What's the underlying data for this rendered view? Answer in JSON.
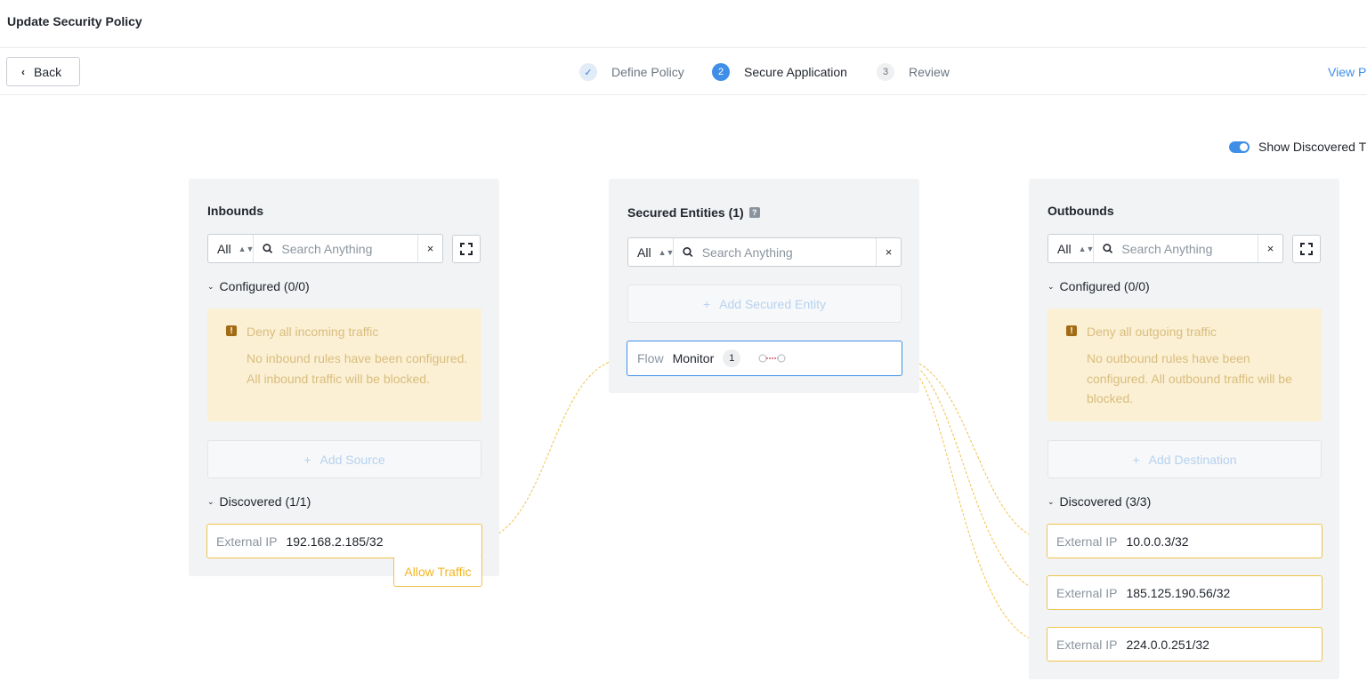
{
  "header": {
    "title": "Update Security Policy"
  },
  "nav": {
    "back_label": "Back",
    "steps": [
      {
        "marker": "✓",
        "label": "Define Policy",
        "state": "done"
      },
      {
        "marker": "2",
        "label": "Secure Application",
        "state": "active"
      },
      {
        "marker": "3",
        "label": "Review",
        "state": "pending"
      }
    ],
    "view_link": "View P"
  },
  "toggle": {
    "label": "Show Discovered T",
    "on": true
  },
  "inbounds": {
    "title": "Inbounds",
    "filter": "All",
    "search_placeholder": "Search Anything",
    "configured_label": "Configured (0/0)",
    "warning_title": "Deny all incoming traffic",
    "warning_text": "No inbound rules have been configured. All inbound traffic will be blocked.",
    "add_label": "Add Source",
    "discovered_label": "Discovered (1/1)",
    "items": [
      {
        "type": "External IP",
        "value": "192.168.2.185/32",
        "tag": "Allow Traffic"
      }
    ]
  },
  "secured": {
    "title": "Secured Entities (1)",
    "help": "?",
    "filter": "All",
    "search_placeholder": "Search Anything",
    "add_label": "Add Secured Entity",
    "entity": {
      "category": "Flow",
      "name": "Monitor",
      "count": "1"
    }
  },
  "outbounds": {
    "title": "Outbounds",
    "filter": "All",
    "search_placeholder": "Search Anything",
    "configured_label": "Configured (0/0)",
    "warning_title": "Deny all outgoing traffic",
    "warning_text": "No outbound rules have been configured. All outbound traffic will be blocked.",
    "add_label": "Add Destination",
    "discovered_label": "Discovered (3/3)",
    "items": [
      {
        "type": "External IP",
        "value": "10.0.0.3/32"
      },
      {
        "type": "External IP",
        "value": "185.125.190.56/32"
      },
      {
        "type": "External IP",
        "value": "224.0.0.251/32"
      }
    ]
  },
  "colors": {
    "accent": "#3f8fe8",
    "discovered_border": "#f0c24c",
    "warning_bg": "#fcf0d4",
    "warning_text": "#d8bd7e",
    "panel_bg": "#f1f3f5"
  }
}
